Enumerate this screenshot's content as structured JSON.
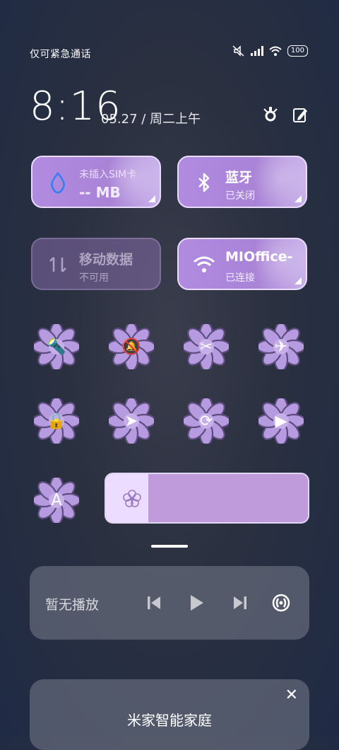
{
  "status_bar": {
    "carrier_text": "仅可紧急通话",
    "battery": "100",
    "icons": [
      "mute-icon",
      "signal-icon",
      "wifi-icon",
      "battery-icon"
    ]
  },
  "clock": {
    "time": "8:16",
    "date": "05.27 / 周二上午",
    "tools": [
      "edit-icon",
      "settings-icon"
    ]
  },
  "tiles": [
    {
      "name": "data-usage",
      "title": "未插入SIM卡",
      "sub": "-- MB",
      "icon": "droplet-icon",
      "state": "active"
    },
    {
      "name": "bluetooth",
      "title": "蓝牙",
      "sub": "已关闭",
      "icon": "bluetooth-icon",
      "state": "active"
    },
    {
      "name": "mobile-data",
      "title": "移动数据",
      "sub": "不可用",
      "icon": "data-arrows-icon",
      "state": "disabled"
    },
    {
      "name": "wifi",
      "title": "MIOffice-",
      "sub": "已连接",
      "icon": "wifi-icon",
      "state": "active"
    }
  ],
  "toggles": [
    {
      "name": "flashlight",
      "icon": "flashlight-icon",
      "glyph": "🔦"
    },
    {
      "name": "silent-mode",
      "icon": "bell-off-icon",
      "glyph": "🔕"
    },
    {
      "name": "screenshot",
      "icon": "screenshot-icon",
      "glyph": "✂"
    },
    {
      "name": "airplane-mode",
      "icon": "airplane-icon",
      "glyph": "✈"
    },
    {
      "name": "lock-screen",
      "icon": "lock-icon",
      "glyph": "🔒"
    },
    {
      "name": "location",
      "icon": "location-arrow-icon",
      "glyph": "➤"
    },
    {
      "name": "rotation-lock",
      "icon": "rotation-lock-icon",
      "glyph": "⟳"
    },
    {
      "name": "screen-record",
      "icon": "video-camera-icon",
      "glyph": "▶"
    },
    {
      "name": "auto-brightness",
      "icon": "font-a-icon",
      "glyph": "A"
    }
  ],
  "brightness": {
    "level": 0.21,
    "icon": "flower-sun-icon"
  },
  "media": {
    "label": "暂无播放",
    "controls": [
      "previous-icon",
      "play-icon",
      "next-icon",
      "cast-icon"
    ]
  },
  "smart_home": {
    "title": "米家智能家庭",
    "close_icon": "close-icon"
  },
  "colors": {
    "tile": "#b18be0",
    "flower_petal": "#b79be0",
    "flower_outline": "#5c4d7e",
    "slider": "#bf9bdc"
  }
}
